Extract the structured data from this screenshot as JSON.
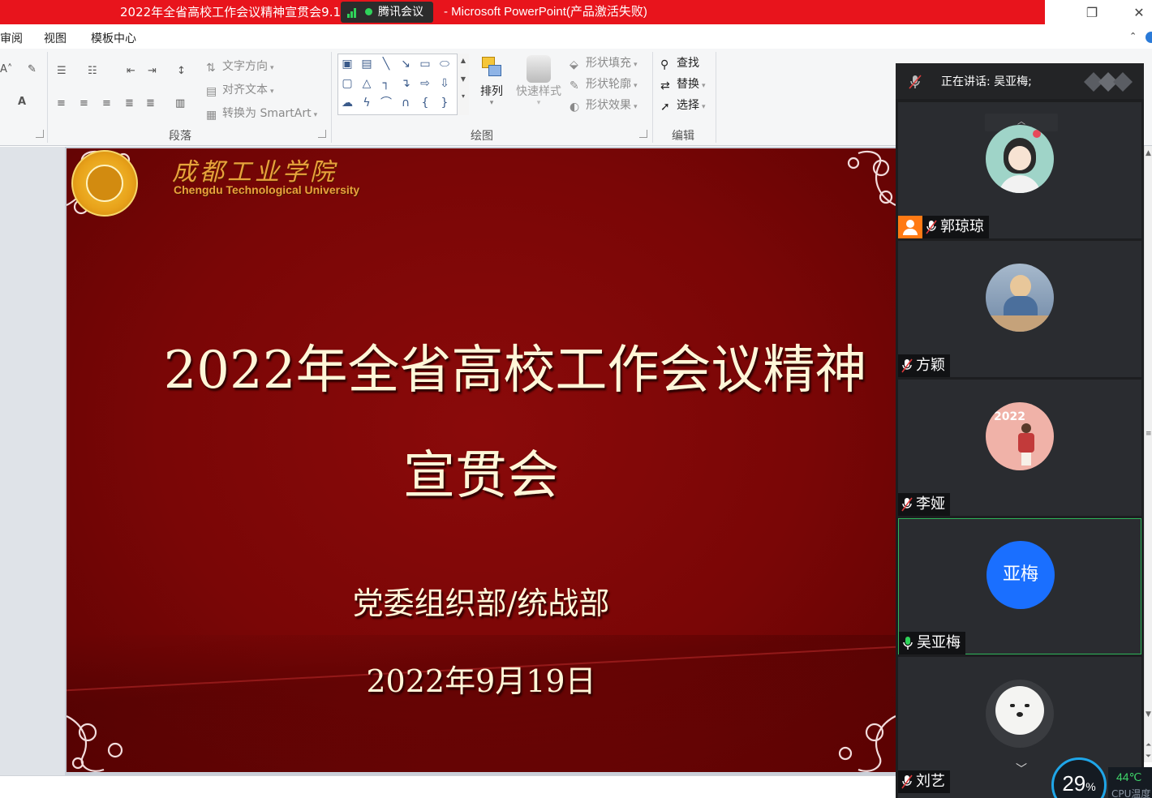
{
  "window": {
    "title_left": "2022年全省高校工作会议精神宣贯会9.19",
    "title_right": "- Microsoft PowerPoint(产品激活失败)",
    "meeting_app": "腾讯会议"
  },
  "menu": {
    "tabs": [
      "审阅",
      "视图",
      "模板中心"
    ]
  },
  "ribbon": {
    "paragraph": {
      "label": "段落",
      "text_direction": "文字方向",
      "align_text": "对齐文本",
      "smartart": "转换为 SmartArt"
    },
    "drawing": {
      "label": "绘图",
      "arrange": "排列",
      "quick_styles": "快速样式",
      "shape_fill": "形状填充",
      "shape_outline": "形状轮廓",
      "shape_effects": "形状效果"
    },
    "editing": {
      "label": "编辑",
      "find": "查找",
      "replace": "替换",
      "select": "选择"
    }
  },
  "slide": {
    "logo_cn": "成都工业学院",
    "logo_en": "Chengdu Technological University",
    "title_line1": "2022年全省高校工作会议精神",
    "title_line2": "宣贯会",
    "department": "党委组织部/统战部",
    "date": "2022年9月19日"
  },
  "meeting": {
    "speaking_label": "正在讲话: 吴亚梅;",
    "participants": [
      {
        "name": "郭琼琼",
        "mic": "muted",
        "host": true,
        "avatar": "girl-illustration-avatar"
      },
      {
        "name": "方颖",
        "mic": "muted",
        "host": false,
        "avatar": "child-photo-avatar"
      },
      {
        "name": "李娅",
        "mic": "muted",
        "host": false,
        "avatar": "balloon-girl-avatar"
      },
      {
        "name": "吴亚梅",
        "mic": "on",
        "host": false,
        "avatar_text": "亚梅",
        "active": true
      },
      {
        "name": "刘艺",
        "mic": "muted",
        "host": false,
        "avatar": "white-dog-avatar"
      }
    ],
    "colors": {
      "active_border": "#2fb65a",
      "initials_bg": "#1a6fff",
      "host_badge": "#ff7a14"
    }
  },
  "system": {
    "cpu_percent": "29",
    "cpu_percent_unit": "%",
    "cpu_temp": "44℃",
    "cpu_label": "CPU温度"
  }
}
